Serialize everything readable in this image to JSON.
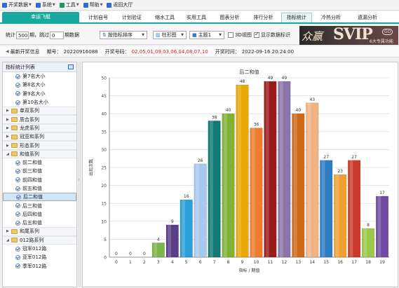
{
  "menu": [
    {
      "label": "开奖数据",
      "icon": "download-icon",
      "color": "#2d6fd1",
      "dropdown": true
    },
    {
      "label": "系统",
      "icon": "settings-icon",
      "color": "#2d6fd1",
      "dropdown": true
    },
    {
      "label": "工具",
      "icon": "tools-icon",
      "color": "#1a9b5a",
      "dropdown": true
    },
    {
      "label": "帮助",
      "icon": "help-icon",
      "color": "#2d6fd1",
      "dropdown": true
    },
    {
      "label": "返回大厅",
      "icon": "back-icon",
      "color": "#2d6fd1",
      "dropdown": false
    }
  ],
  "brand_tab": "幸运飞艇",
  "tabs": [
    "计划自号",
    "计划验证",
    "缩水工具",
    "实用工具",
    "图表分析",
    "排行分析",
    "指标统计",
    "冷热分析",
    "遗漏分析"
  ],
  "active_tab": 6,
  "toolbar": {
    "stat_label": "统计",
    "stat_value": "500",
    "period_label": "期，",
    "skip_label": "跳过",
    "skip_value": "0",
    "skip_suffix": "期数据",
    "sort_select": "按指标排序",
    "chart_select": "柱形图",
    "theme_select": "主题1",
    "view3d_label": "3D视图",
    "view3d_checked": false,
    "showlabel_label": "显示数据标识",
    "showlabel_checked": true
  },
  "banner": {
    "cn": "众赢",
    "svip": "SVIP",
    "go": "GO",
    "sub": "6大专属功能"
  },
  "info": {
    "latest_label": "最新开奖信息",
    "period_label": "期号：",
    "period_value": "20220916088",
    "numbers_label": "开奖号码：",
    "numbers_value": "02,05,01,09,03,06,04,08,07,10",
    "time_label": "开奖时间：",
    "time_value": "2022-09-16 20:24:00",
    "numbers_color": "#d42020"
  },
  "sidebar": {
    "title": "指标统计列表",
    "items": [
      {
        "type": "child",
        "label": "第7名大小"
      },
      {
        "type": "child",
        "label": "第8名大小"
      },
      {
        "type": "child",
        "label": "第9名大小"
      },
      {
        "type": "child",
        "label": "第10名大小"
      },
      {
        "type": "group",
        "label": "单双系列",
        "expanded": false
      },
      {
        "type": "group",
        "label": "质合系列",
        "expanded": false
      },
      {
        "type": "group",
        "label": "龙虎系列",
        "expanded": false
      },
      {
        "type": "group",
        "label": "冠亚和系列",
        "expanded": false
      },
      {
        "type": "group",
        "label": "形态系列",
        "expanded": false
      },
      {
        "type": "group",
        "label": "和值系列",
        "expanded": true
      },
      {
        "type": "child",
        "label": "前二和值"
      },
      {
        "type": "child",
        "label": "前三和值"
      },
      {
        "type": "child",
        "label": "前四和值"
      },
      {
        "type": "child",
        "label": "前五和值"
      },
      {
        "type": "child",
        "label": "后二和值",
        "selected": true
      },
      {
        "type": "child",
        "label": "后三和值"
      },
      {
        "type": "child",
        "label": "后四和值"
      },
      {
        "type": "child",
        "label": "后五和值"
      },
      {
        "type": "group",
        "label": "和尾系列",
        "expanded": false
      },
      {
        "type": "group",
        "label": "012路系列",
        "expanded": true
      },
      {
        "type": "child",
        "label": "冠军012路"
      },
      {
        "type": "child",
        "label": "亚军012路"
      },
      {
        "type": "child",
        "label": "季军012路"
      }
    ]
  },
  "chart_data": {
    "type": "bar",
    "title": "后二和值",
    "xlabel": "指标 / 期值",
    "ylabel": "出现次数",
    "ylim": [
      0,
      50
    ],
    "yticks": [
      0,
      5,
      10,
      15,
      20,
      25,
      30,
      35,
      40,
      45,
      50
    ],
    "categories": [
      "0",
      "1",
      "2",
      "3",
      "4",
      "5",
      "6",
      "7",
      "8",
      "9",
      "10",
      "11",
      "12",
      "13",
      "14",
      "15",
      "16",
      "17",
      "18",
      "19"
    ],
    "values": [
      0,
      0,
      0,
      4,
      9,
      16,
      26,
      38,
      40,
      48,
      36,
      49,
      49,
      40,
      43,
      27,
      23,
      27,
      8,
      17
    ],
    "colors": [
      "#888888",
      "#888888",
      "#888888",
      "#7ab648",
      "#5b3e8a",
      "#2a9fd8",
      "#a9c8ee",
      "#127a74",
      "#7fb234",
      "#e8a800",
      "#ef7b2d",
      "#9b1b1b",
      "#8a74a8",
      "#d06a18",
      "#f2b384",
      "#2e7cc4",
      "#f0a030",
      "#c83a2a",
      "#9bc84a",
      "#6e4ba0"
    ],
    "grid": true,
    "legend": "none"
  }
}
